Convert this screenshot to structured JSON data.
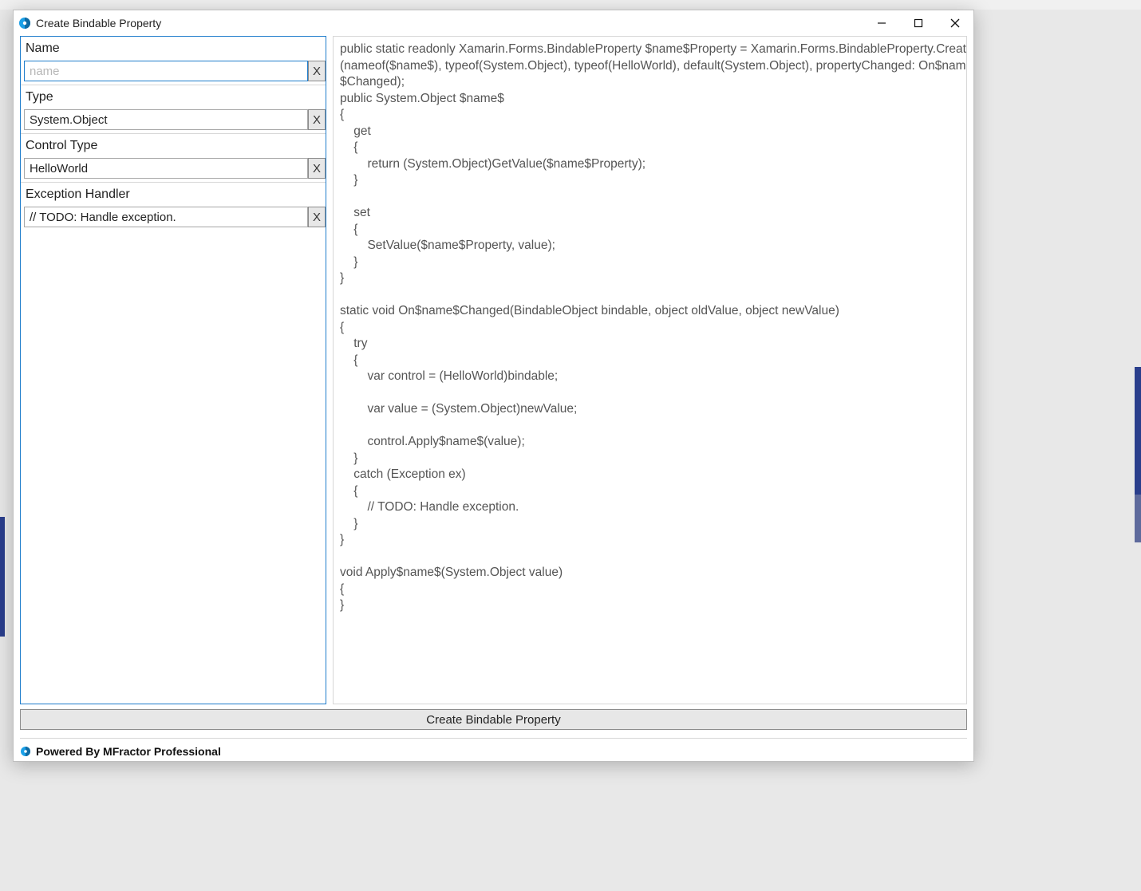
{
  "window": {
    "title": "Create Bindable Property"
  },
  "form": {
    "name_label": "Name",
    "name_value": "",
    "name_placeholder": "name",
    "type_label": "Type",
    "type_value": "System.Object",
    "control_type_label": "Control Type",
    "control_type_value": "HelloWorld",
    "exception_handler_label": "Exception Handler",
    "exception_handler_value": "// TODO: Handle exception.",
    "clear_button_label": "X"
  },
  "preview": {
    "code": "public static readonly Xamarin.Forms.BindableProperty $name$Property = Xamarin.Forms.BindableProperty.Create\n(nameof($name$), typeof(System.Object), typeof(HelloWorld), default(System.Object), propertyChanged: On$name\n$Changed);\npublic System.Object $name$\n{\n    get\n    {\n        return (System.Object)GetValue($name$Property);\n    }\n\n    set\n    {\n        SetValue($name$Property, value);\n    }\n}\n\nstatic void On$name$Changed(BindableObject bindable, object oldValue, object newValue)\n{\n    try\n    {\n        var control = (HelloWorld)bindable;\n\n        var value = (System.Object)newValue;\n\n        control.Apply$name$(value);\n    }\n    catch (Exception ex)\n    {\n        // TODO: Handle exception.\n    }\n}\n\nvoid Apply$name$(System.Object value)\n{\n}"
  },
  "actions": {
    "create_button_label": "Create Bindable Property"
  },
  "footer": {
    "text": "Powered By MFractor Professional"
  }
}
